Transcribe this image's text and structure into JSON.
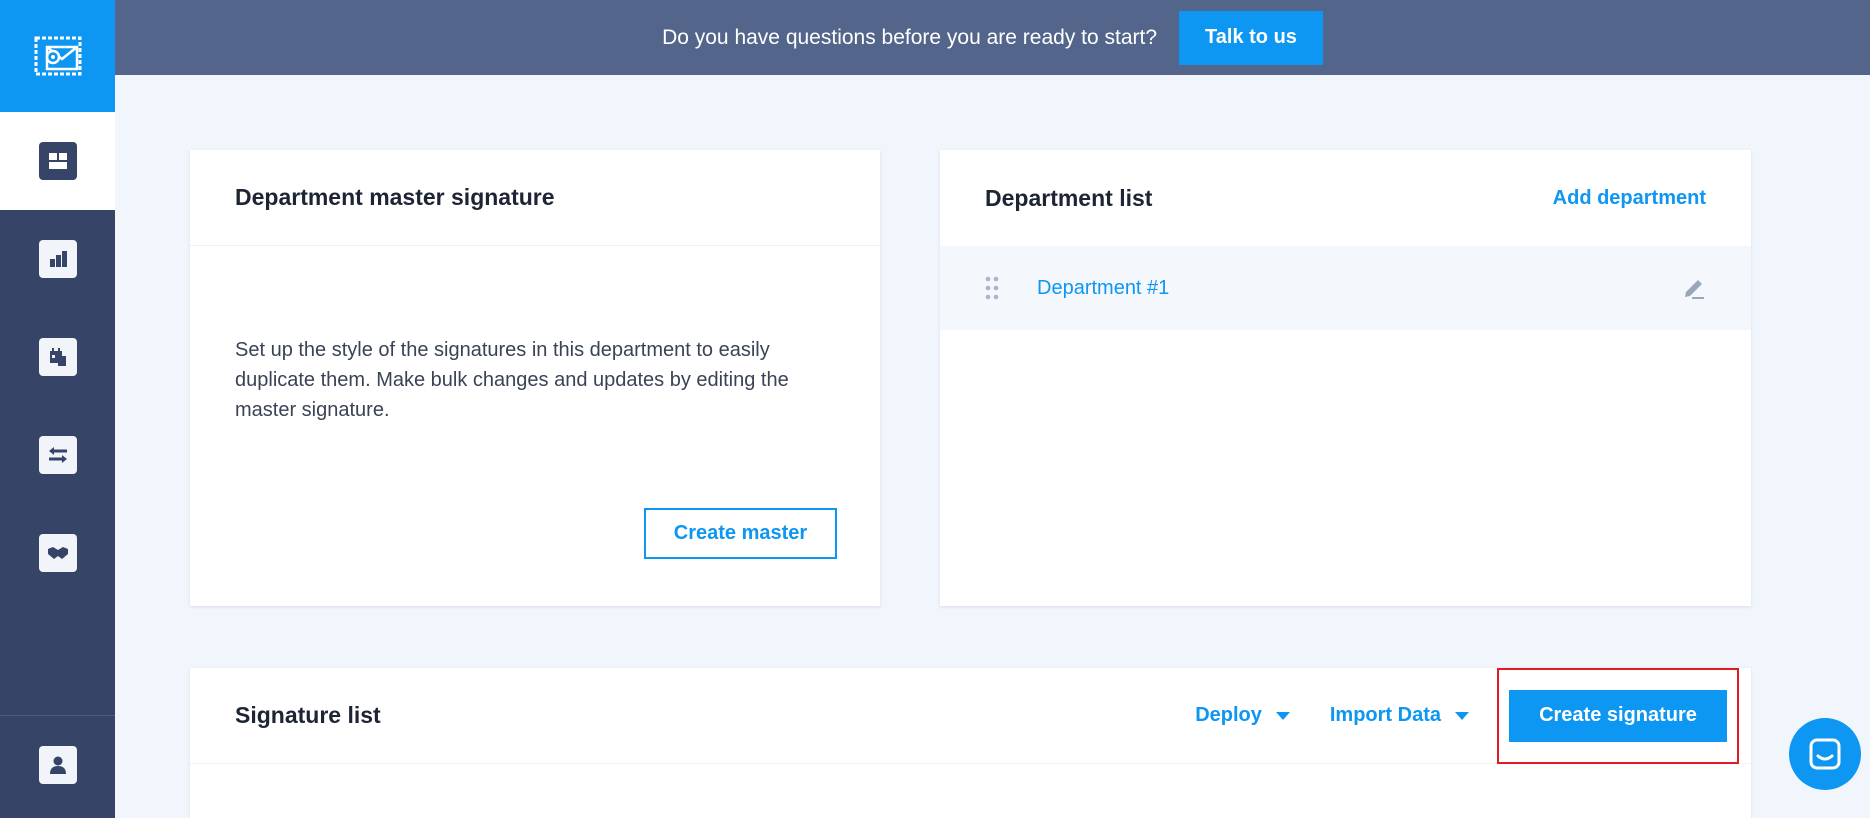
{
  "banner": {
    "text": "Do you have questions before you are ready to start?",
    "button_label": "Talk to us"
  },
  "sidebar": {
    "items": [
      {
        "icon": "dashboard-icon",
        "active": true
      },
      {
        "icon": "bar-chart-icon",
        "active": false
      },
      {
        "icon": "calendar-icon",
        "active": false
      },
      {
        "icon": "transfer-icon",
        "active": false
      },
      {
        "icon": "handshake-icon",
        "active": false
      }
    ],
    "bottom_icon": "user-icon"
  },
  "master_card": {
    "title": "Department master signature",
    "description": "Set up the style of the signatures in this department to easily duplicate them. Make bulk changes and updates by editing the master signature.",
    "button_label": "Create master"
  },
  "department_card": {
    "title": "Department list",
    "add_label": "Add department",
    "departments": [
      {
        "name": "Department #1"
      }
    ]
  },
  "signature_card": {
    "title": "Signature list",
    "deploy_label": "Deploy",
    "import_label": "Import Data",
    "create_label": "Create signature"
  },
  "colors": {
    "brand_blue": "#0d96f2",
    "sidebar": "#364467",
    "banner": "#54658b",
    "highlight": "#e01b24"
  }
}
